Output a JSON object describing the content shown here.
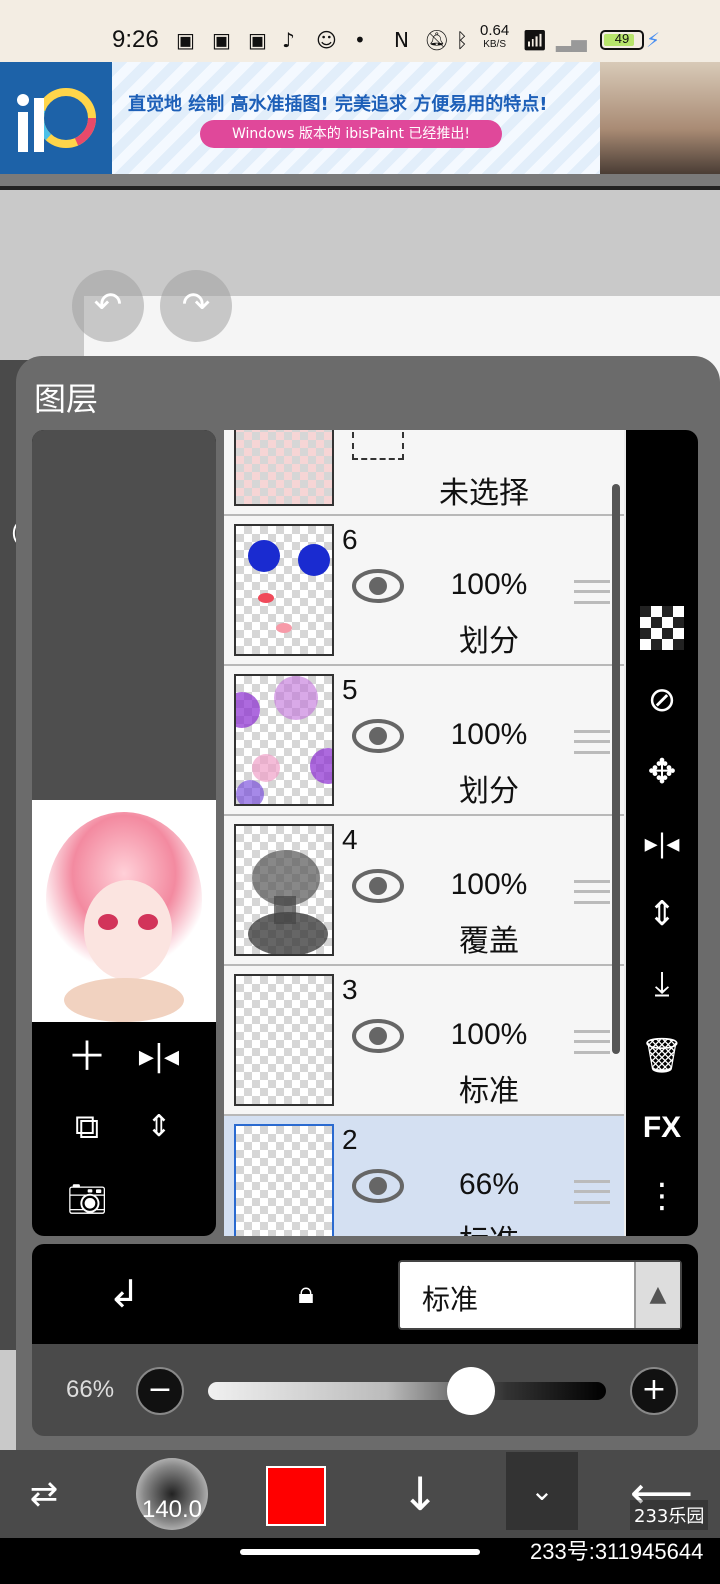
{
  "status_bar": {
    "time": "9:26",
    "net_speed": "0.64",
    "net_unit": "KB/S",
    "battery": "49"
  },
  "ad": {
    "headline": "直觉地 绘制 高水准插图! 完美追求 方便易用的特点!",
    "sub": "Windows 版本的 ibisPaint 已经推出!"
  },
  "panel": {
    "title": "图层"
  },
  "layers": [
    {
      "number": "",
      "opacity": "",
      "blend": "未选择"
    },
    {
      "number": "6",
      "opacity": "100%",
      "blend": "划分"
    },
    {
      "number": "5",
      "opacity": "100%",
      "blend": "划分"
    },
    {
      "number": "4",
      "opacity": "100%",
      "blend": "覆盖"
    },
    {
      "number": "3",
      "opacity": "100%",
      "blend": "标准"
    },
    {
      "number": "2",
      "opacity": "66%",
      "blend": "标准"
    }
  ],
  "blend_mode": {
    "value": "标准"
  },
  "opacity_slider": {
    "label": "66%",
    "value": 0.66
  },
  "brush": {
    "size": "140.0"
  },
  "color": {
    "current": "#ff0000",
    "accent": "#1d62a8"
  },
  "right_tools": {
    "fx_label": "FX"
  },
  "watermark": {
    "text": "233号:311945644",
    "logo": "233乐园"
  }
}
